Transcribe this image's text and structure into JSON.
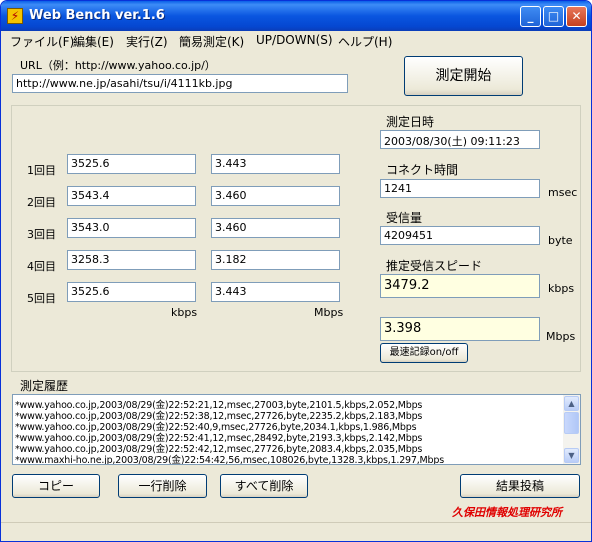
{
  "window": {
    "title": "Web Bench ver.1.6",
    "minimize": "_",
    "maximize": "□",
    "close": "✕"
  },
  "menu": [
    "ファイル(F)",
    "編集(E)",
    "実行(Z)",
    "簡易測定(K)",
    "UP/DOWN(S)",
    "ヘルプ(H)"
  ],
  "url": {
    "label": "URL（例：http://www.yahoo.co.jp/）",
    "value": "http://www.ne.jp/asahi/tsu/i/4111kb.jpg"
  },
  "start_button": "測定開始",
  "runs": [
    {
      "label": "1回目",
      "kbps": "3525.6",
      "mbps": "3.443"
    },
    {
      "label": "2回目",
      "kbps": "3543.4",
      "mbps": "3.460"
    },
    {
      "label": "3回目",
      "kbps": "3543.0",
      "mbps": "3.460"
    },
    {
      "label": "4回目",
      "kbps": "3258.3",
      "mbps": "3.182"
    },
    {
      "label": "5回目",
      "kbps": "3525.6",
      "mbps": "3.443"
    }
  ],
  "units": {
    "kbps": "kbps",
    "mbps": "Mbps",
    "msec": "msec",
    "byte": "byte"
  },
  "datetime": {
    "label": "測定日時",
    "value": "2003/08/30(土) 09:11:23"
  },
  "connect": {
    "label": "コネクト時間",
    "value": "1241"
  },
  "received": {
    "label": "受信量",
    "value": "4209451"
  },
  "speed": {
    "label": "推定受信スピード",
    "kbps_value": "3479.2",
    "mbps_value": "3.398"
  },
  "record_button": "最速記録on/off",
  "history": {
    "label": "測定履歴",
    "rows": [
      "*www.yahoo.co.jp,2003/08/29(金)22:52:21,12,msec,27003,byte,2101.5,kbps,2.052,Mbps",
      "*www.yahoo.co.jp,2003/08/29(金)22:52:38,12,msec,27726,byte,2235.2,kbps,2.183,Mbps",
      "*www.yahoo.co.jp,2003/08/29(金)22:52:40,9,msec,27726,byte,2034.1,kbps,1.986,Mbps",
      "*www.yahoo.co.jp,2003/08/29(金)22:52:41,12,msec,28492,byte,2193.3,kbps,2.142,Mbps",
      "*www.yahoo.co.jp,2003/08/29(金)22:52:42,12,msec,27726,byte,2083.4,kbps,2.035,Mbps",
      "*www.maxhi-ho.ne.jp,2003/08/29(金)22:54:42,56,msec,108026,byte,1328.3,kbps,1.297,Mbps"
    ]
  },
  "buttons": {
    "copy": "コピー",
    "delete_line": "一行削除",
    "delete_all": "すべて削除",
    "post": "結果投稿"
  },
  "credit": "久保田情報処理研究所"
}
